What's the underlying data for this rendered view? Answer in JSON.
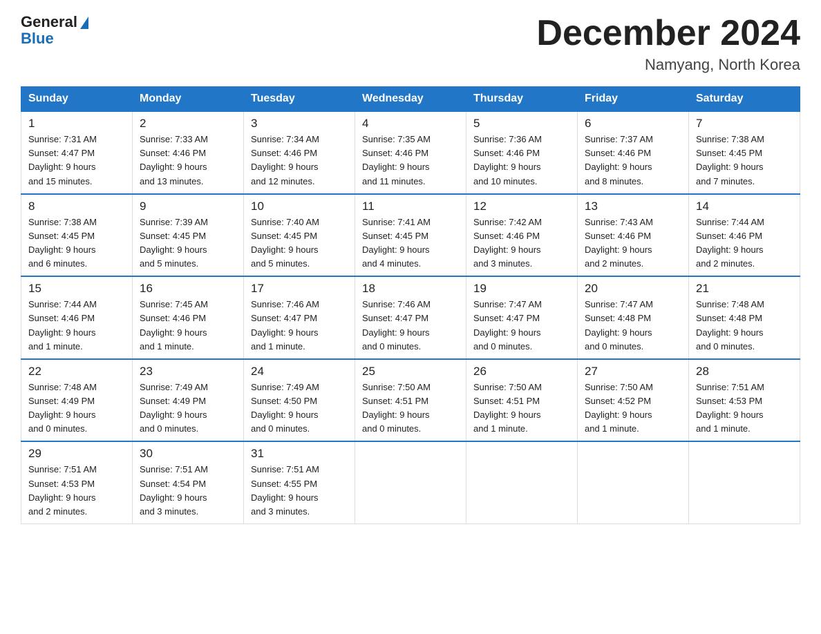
{
  "logo": {
    "general": "General",
    "blue": "Blue"
  },
  "title": "December 2024",
  "location": "Namyang, North Korea",
  "weekdays": [
    "Sunday",
    "Monday",
    "Tuesday",
    "Wednesday",
    "Thursday",
    "Friday",
    "Saturday"
  ],
  "weeks": [
    [
      {
        "day": "1",
        "sunrise": "7:31 AM",
        "sunset": "4:47 PM",
        "daylight": "9 hours and 15 minutes."
      },
      {
        "day": "2",
        "sunrise": "7:33 AM",
        "sunset": "4:46 PM",
        "daylight": "9 hours and 13 minutes."
      },
      {
        "day": "3",
        "sunrise": "7:34 AM",
        "sunset": "4:46 PM",
        "daylight": "9 hours and 12 minutes."
      },
      {
        "day": "4",
        "sunrise": "7:35 AM",
        "sunset": "4:46 PM",
        "daylight": "9 hours and 11 minutes."
      },
      {
        "day": "5",
        "sunrise": "7:36 AM",
        "sunset": "4:46 PM",
        "daylight": "9 hours and 10 minutes."
      },
      {
        "day": "6",
        "sunrise": "7:37 AM",
        "sunset": "4:46 PM",
        "daylight": "9 hours and 8 minutes."
      },
      {
        "day": "7",
        "sunrise": "7:38 AM",
        "sunset": "4:45 PM",
        "daylight": "9 hours and 7 minutes."
      }
    ],
    [
      {
        "day": "8",
        "sunrise": "7:38 AM",
        "sunset": "4:45 PM",
        "daylight": "9 hours and 6 minutes."
      },
      {
        "day": "9",
        "sunrise": "7:39 AM",
        "sunset": "4:45 PM",
        "daylight": "9 hours and 5 minutes."
      },
      {
        "day": "10",
        "sunrise": "7:40 AM",
        "sunset": "4:45 PM",
        "daylight": "9 hours and 5 minutes."
      },
      {
        "day": "11",
        "sunrise": "7:41 AM",
        "sunset": "4:45 PM",
        "daylight": "9 hours and 4 minutes."
      },
      {
        "day": "12",
        "sunrise": "7:42 AM",
        "sunset": "4:46 PM",
        "daylight": "9 hours and 3 minutes."
      },
      {
        "day": "13",
        "sunrise": "7:43 AM",
        "sunset": "4:46 PM",
        "daylight": "9 hours and 2 minutes."
      },
      {
        "day": "14",
        "sunrise": "7:44 AM",
        "sunset": "4:46 PM",
        "daylight": "9 hours and 2 minutes."
      }
    ],
    [
      {
        "day": "15",
        "sunrise": "7:44 AM",
        "sunset": "4:46 PM",
        "daylight": "9 hours and 1 minute."
      },
      {
        "day": "16",
        "sunrise": "7:45 AM",
        "sunset": "4:46 PM",
        "daylight": "9 hours and 1 minute."
      },
      {
        "day": "17",
        "sunrise": "7:46 AM",
        "sunset": "4:47 PM",
        "daylight": "9 hours and 1 minute."
      },
      {
        "day": "18",
        "sunrise": "7:46 AM",
        "sunset": "4:47 PM",
        "daylight": "9 hours and 0 minutes."
      },
      {
        "day": "19",
        "sunrise": "7:47 AM",
        "sunset": "4:47 PM",
        "daylight": "9 hours and 0 minutes."
      },
      {
        "day": "20",
        "sunrise": "7:47 AM",
        "sunset": "4:48 PM",
        "daylight": "9 hours and 0 minutes."
      },
      {
        "day": "21",
        "sunrise": "7:48 AM",
        "sunset": "4:48 PM",
        "daylight": "9 hours and 0 minutes."
      }
    ],
    [
      {
        "day": "22",
        "sunrise": "7:48 AM",
        "sunset": "4:49 PM",
        "daylight": "9 hours and 0 minutes."
      },
      {
        "day": "23",
        "sunrise": "7:49 AM",
        "sunset": "4:49 PM",
        "daylight": "9 hours and 0 minutes."
      },
      {
        "day": "24",
        "sunrise": "7:49 AM",
        "sunset": "4:50 PM",
        "daylight": "9 hours and 0 minutes."
      },
      {
        "day": "25",
        "sunrise": "7:50 AM",
        "sunset": "4:51 PM",
        "daylight": "9 hours and 0 minutes."
      },
      {
        "day": "26",
        "sunrise": "7:50 AM",
        "sunset": "4:51 PM",
        "daylight": "9 hours and 1 minute."
      },
      {
        "day": "27",
        "sunrise": "7:50 AM",
        "sunset": "4:52 PM",
        "daylight": "9 hours and 1 minute."
      },
      {
        "day": "28",
        "sunrise": "7:51 AM",
        "sunset": "4:53 PM",
        "daylight": "9 hours and 1 minute."
      }
    ],
    [
      {
        "day": "29",
        "sunrise": "7:51 AM",
        "sunset": "4:53 PM",
        "daylight": "9 hours and 2 minutes."
      },
      {
        "day": "30",
        "sunrise": "7:51 AM",
        "sunset": "4:54 PM",
        "daylight": "9 hours and 3 minutes."
      },
      {
        "day": "31",
        "sunrise": "7:51 AM",
        "sunset": "4:55 PM",
        "daylight": "9 hours and 3 minutes."
      },
      null,
      null,
      null,
      null
    ]
  ],
  "labels": {
    "sunrise": "Sunrise:",
    "sunset": "Sunset:",
    "daylight": "Daylight:"
  }
}
